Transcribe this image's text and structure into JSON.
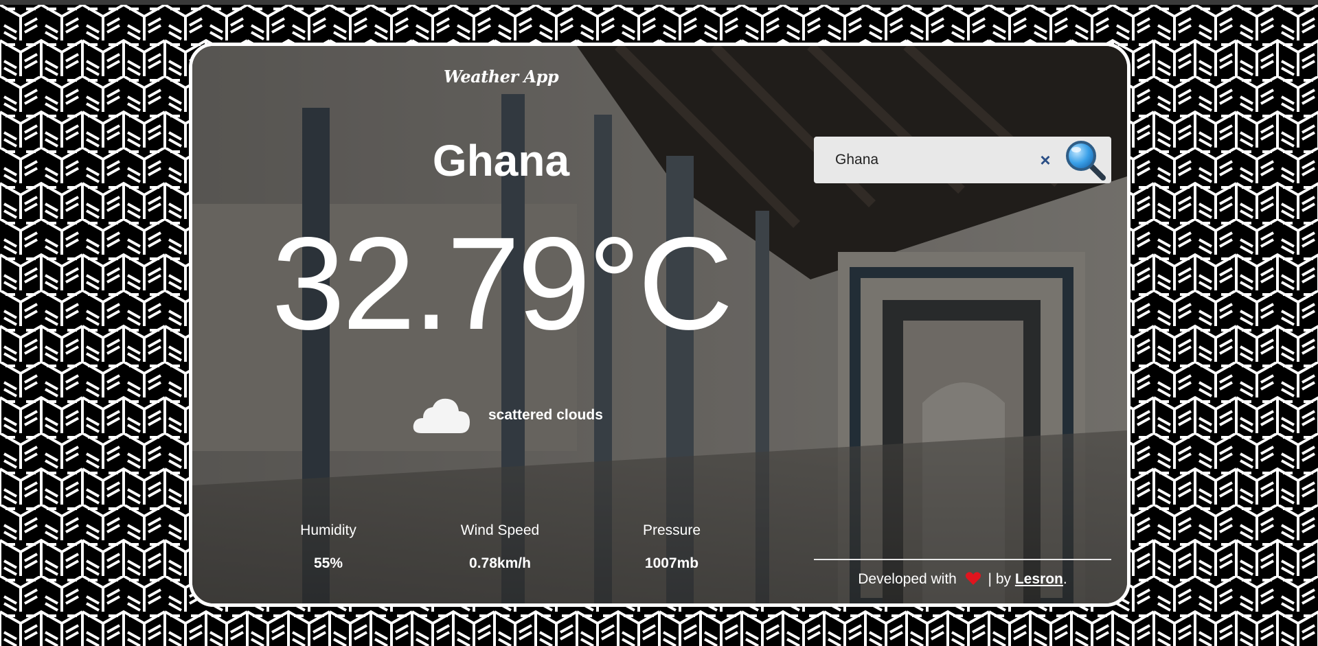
{
  "app": {
    "title": "Weather App"
  },
  "weather": {
    "city": "Ghana",
    "temperature": "32.79°C",
    "description": "scattered clouds",
    "condition_icon": "cloud-icon"
  },
  "stats": [
    {
      "label": "Humidity",
      "value": "55%"
    },
    {
      "label": "Wind Speed",
      "value": "0.78km/h"
    },
    {
      "label": "Pressure",
      "value": "1007mb"
    }
  ],
  "search": {
    "value": "Ghana",
    "clear_label": "×",
    "search_icon": "magnifier-icon"
  },
  "footer": {
    "prefix": "Developed with",
    "separator": "| by",
    "author": "Lesron",
    "suffix": ".",
    "heart_icon": "heart-icon"
  },
  "colors": {
    "card_border": "#ffffff",
    "search_bg": "#e8e8e8",
    "clear_icon": "#2b4f86",
    "heart": "#e0141e"
  }
}
